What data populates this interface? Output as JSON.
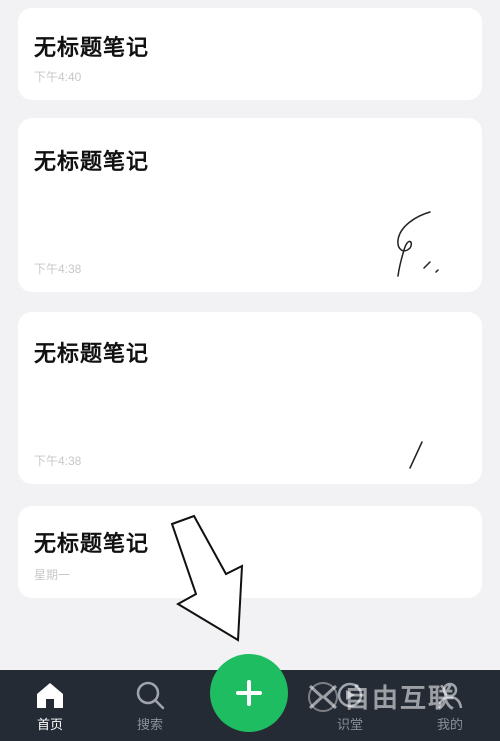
{
  "notes": [
    {
      "title": "无标题笔记",
      "time": "下午4:40"
    },
    {
      "title": "无标题笔记",
      "time": "下午4:38"
    },
    {
      "title": "无标题笔记",
      "time": "下午4:38"
    },
    {
      "title": "无标题笔记",
      "time": "星期一"
    }
  ],
  "tabbar": {
    "home_label": "首页",
    "search_label": "搜索",
    "add_icon": "plus-icon",
    "classroom_label": "识堂",
    "profile_label": "我的"
  },
  "watermark": {
    "text": "自由互联"
  },
  "colors": {
    "background": "#f2f2f4",
    "card": "#ffffff",
    "tabbar": "#252b35",
    "accent": "#1fbd62",
    "time_text": "#c8c8c8"
  }
}
